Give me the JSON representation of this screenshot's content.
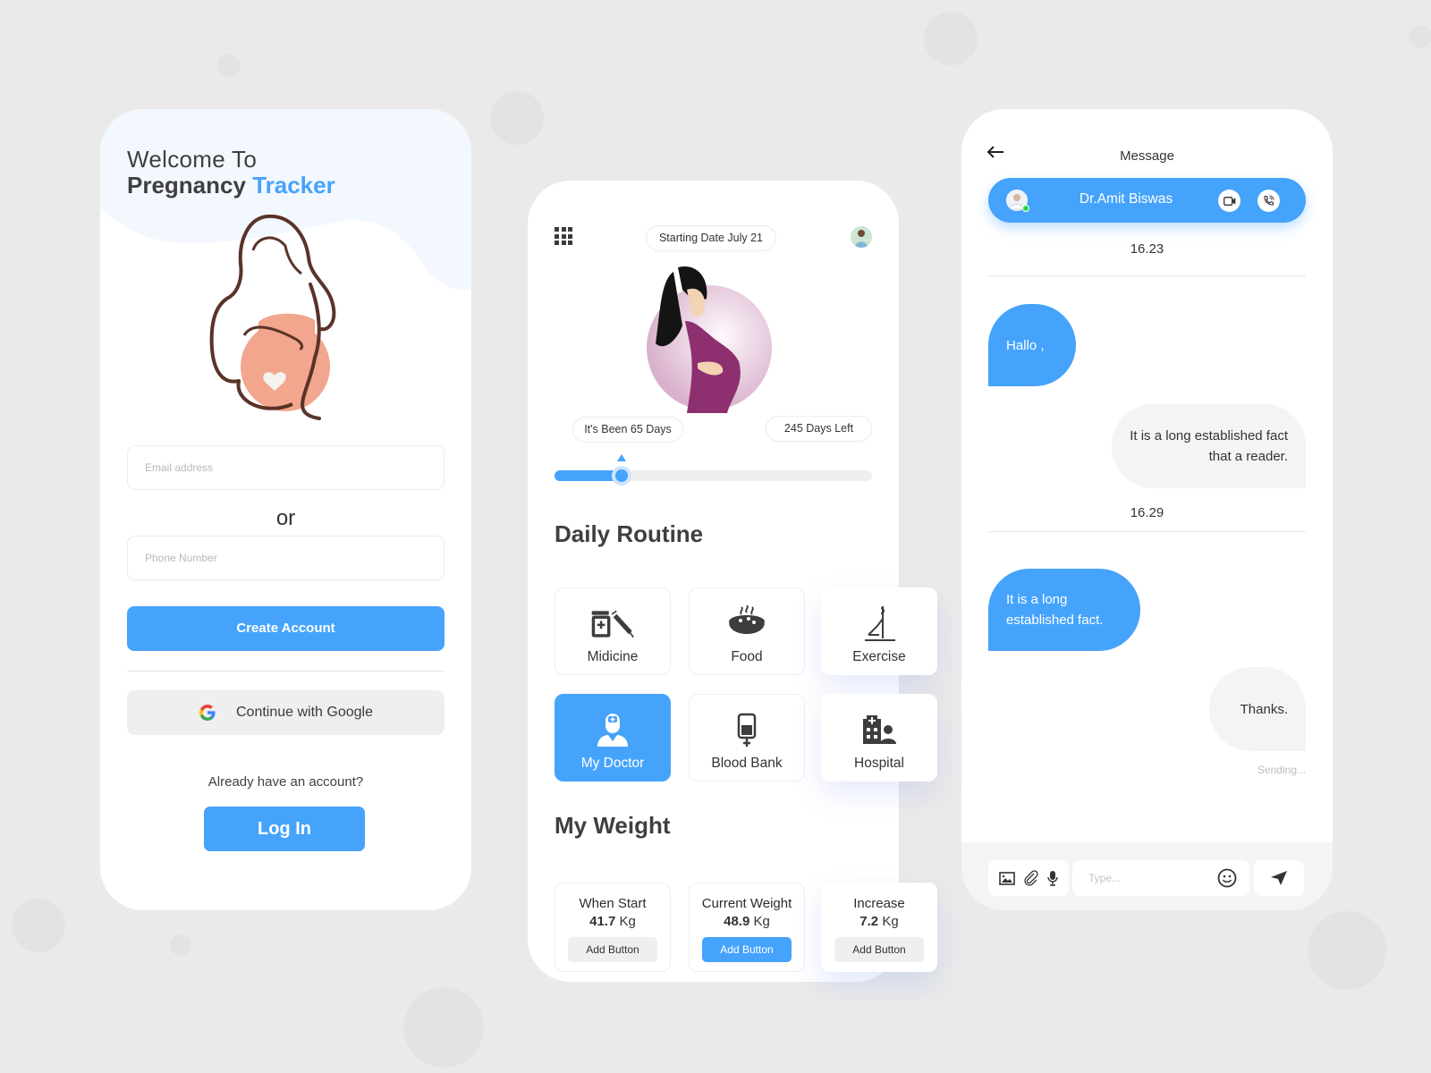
{
  "colors": {
    "accent": "#45a3fb",
    "background": "#eaeaea",
    "text": "#3a3a3a"
  },
  "login": {
    "welcome_line1": "Welcome To",
    "welcome_brand": "Pregnancy",
    "welcome_accent": "Tracker",
    "email_placeholder": "Email address",
    "or_label": "or",
    "phone_placeholder": "Phone Number",
    "create_account_label": "Create Account",
    "google_label": "Continue with Google",
    "already_text": "Already have an account?",
    "login_label": "Log In"
  },
  "home": {
    "menu_icon": "grid-icon",
    "start_date": "Starting Date July 21",
    "days_been": "It's Been 65 Days",
    "days_left": "245 Days Left",
    "progress": {
      "elapsed_days": 65,
      "remaining_days": 245,
      "fraction": 0.21
    },
    "daily_routine_title": "Daily Routine",
    "routine_tiles": [
      {
        "label": "Midicine",
        "icon": "medicine-syringe-icon",
        "active": false
      },
      {
        "label": "Food",
        "icon": "hot-bowl-icon",
        "active": false
      },
      {
        "label": "Exercise",
        "icon": "yoga-pose-icon",
        "active": false
      },
      {
        "label": "My Doctor",
        "icon": "doctor-icon",
        "active": true
      },
      {
        "label": "Blood Bank",
        "icon": "blood-bag-icon",
        "active": false
      },
      {
        "label": "Hospital",
        "icon": "hospital-icon",
        "active": false
      }
    ],
    "weight_title": "My Weight",
    "weight_cards": [
      {
        "title": "When Start",
        "value": "41.7",
        "unit": "Kg",
        "button": "Add Button",
        "active": false
      },
      {
        "title": "Current Weight",
        "value": "48.9",
        "unit": "Kg",
        "button": "Add Button",
        "active": true
      },
      {
        "title": "Increase",
        "value": "7.2",
        "unit": "Kg",
        "button": "Add Button",
        "active": false
      }
    ]
  },
  "chat": {
    "title": "Message",
    "doctor_name": "Dr.Amit Biswas",
    "doctor_status": "online",
    "messages": [
      {
        "type": "time",
        "text": "16.23"
      },
      {
        "type": "in",
        "text": "Hallo ,"
      },
      {
        "type": "out",
        "text": "It is a long established fact that a reader."
      },
      {
        "type": "time",
        "text": "16.29"
      },
      {
        "type": "in",
        "text": "It is a long established fact."
      },
      {
        "type": "out",
        "text": "Thanks."
      }
    ],
    "sending_status": "Sending...",
    "input_placeholder": "Type..."
  }
}
